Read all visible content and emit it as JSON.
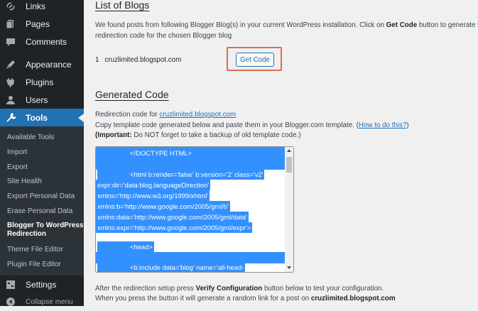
{
  "sidebar": {
    "menu": [
      {
        "label": "Links",
        "icon": "links-icon"
      },
      {
        "label": "Pages",
        "icon": "pages-icon"
      },
      {
        "label": "Comments",
        "icon": "comments-icon"
      },
      {
        "label": "Appearance",
        "icon": "appearance-icon"
      },
      {
        "label": "Plugins",
        "icon": "plugins-icon"
      },
      {
        "label": "Users",
        "icon": "users-icon"
      },
      {
        "label": "Tools",
        "icon": "tools-icon"
      }
    ],
    "submenu": [
      "Available Tools",
      "Import",
      "Export",
      "Site Health",
      "Export Personal Data",
      "Erase Personal Data"
    ],
    "current_submenu": {
      "line1": "Blogger To WordPress",
      "line2": "Redirection"
    },
    "submenu_after": [
      "Theme File Editor",
      "Plugin File Editor"
    ],
    "settings_label": "Settings",
    "collapse_label": "Collapse menu"
  },
  "main": {
    "list_title": "List of Blogs",
    "intro_part1": "We found posts from following Blogger Blog(s) in your current WordPress installation. Click on ",
    "intro_bold": "Get Code",
    "intro_part2": " button to generate the",
    "intro_line2": "redirection code for the chosen Blogger blog",
    "blog_index": "1",
    "blog_name": "cruzlimited.blogspot.com",
    "get_code_label": "Get Code",
    "generated_title": "Generated Code",
    "redir_prefix": "Redirection code for ",
    "redir_link": "cruzlimited.blogspot.com",
    "copy_text": "Copy template code generated below and paste them in your Blogger.com template. (",
    "howto_link": "How to do this?",
    "copy_close": ")",
    "important_label": "(Important:",
    "important_text": " Do NOT forget to take a backup of old template code.)",
    "code_lines": [
      "<!DOCTYPE HTML>",
      "<html b:render='false' b:version='2' class='v2'",
      "expr:dir='data:blog.languageDirection'",
      "xmlns='http://www.w3.org/1999/xhtml'",
      "xmlns:b='http://www.google.com/2005/gml/b'",
      "xmlns:data='http://www.google.com/2005/gml/data'",
      "xmlns:expr='http://www.google.com/2005/gml/expr'>",
      "<head>",
      "<b:include data='blog' name='all-head-"
    ],
    "after_part1": "After the redirection setup press ",
    "after_bold": "Verify Configuration",
    "after_part2": " button below to test your configuration.",
    "when_part1": "When you press the button it will generate a random link for a post on ",
    "when_bold": "cruzlimited.blogspot.com"
  },
  "colors": {
    "sidebar_bg": "#1d2327",
    "active": "#2271b1",
    "highlight": "#3390ff",
    "callout": "#e06b57"
  }
}
